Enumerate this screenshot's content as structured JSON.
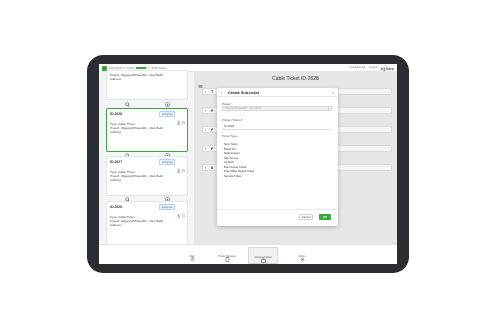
{
  "topbar": {
    "left_text_1": "04/07/2025 07:27 AM",
    "left_text_2": "BOM Tracker",
    "progress": 0.75,
    "right_text_1": "jsmith@email",
    "right_text_2": "Logout",
    "logo": "IQGeo"
  },
  "cards": [
    {
      "id": "",
      "badge": "",
      "lines": [
        "Project: Wigwam/Phase001 - New Build",
        "Address"
      ]
    },
    {
      "id": "ID-2628",
      "badge": "Assigned",
      "lines": [
        "Type: Cable Ticket",
        "Project: Wigwam/Phase001 - New Build",
        "Address"
      ]
    },
    {
      "id": "ID-2627",
      "badge": "Assigned",
      "lines": [
        "Type: Cable Ticket",
        "Project: Wigwam/Phase001 - New Build",
        "Address"
      ]
    },
    {
      "id": "ID-2626",
      "badge": "Assigned",
      "lines": [
        "Type: Cable Ticket",
        "Project: Wigwam/Phase001 - New Build",
        "Address"
      ]
    }
  ],
  "ticket": {
    "title": "Cable Ticket ID-2628",
    "sections": [
      "T",
      "P",
      "P",
      "P",
      "S"
    ]
  },
  "modal": {
    "title": "Create Sub-ticket",
    "project_label": "Project",
    "project_value": "Wigwam/Phase001 - New Build",
    "primary_label": "Primary Ticket #",
    "primary_value": "ID-2628",
    "ticket_types_label": "Ticket Types",
    "ticket_types": [
      "New Ticket",
      "Break Fix",
      "Maintenance",
      "Site Survey",
      "As-Built",
      "Bore Route Ticket",
      "Pole Make Ready Ticket",
      "Service Ticket"
    ],
    "cancel_label": "Cancel",
    "ok_label": "OK"
  },
  "nav": [
    {
      "label": "Map",
      "icon": "map-pin-icon"
    },
    {
      "label": "Ticket Manager",
      "icon": "clipboard-icon"
    },
    {
      "label": "Assigned Work",
      "icon": "briefcase-icon"
    },
    {
      "label": "Admin",
      "icon": "gear-icon"
    }
  ]
}
